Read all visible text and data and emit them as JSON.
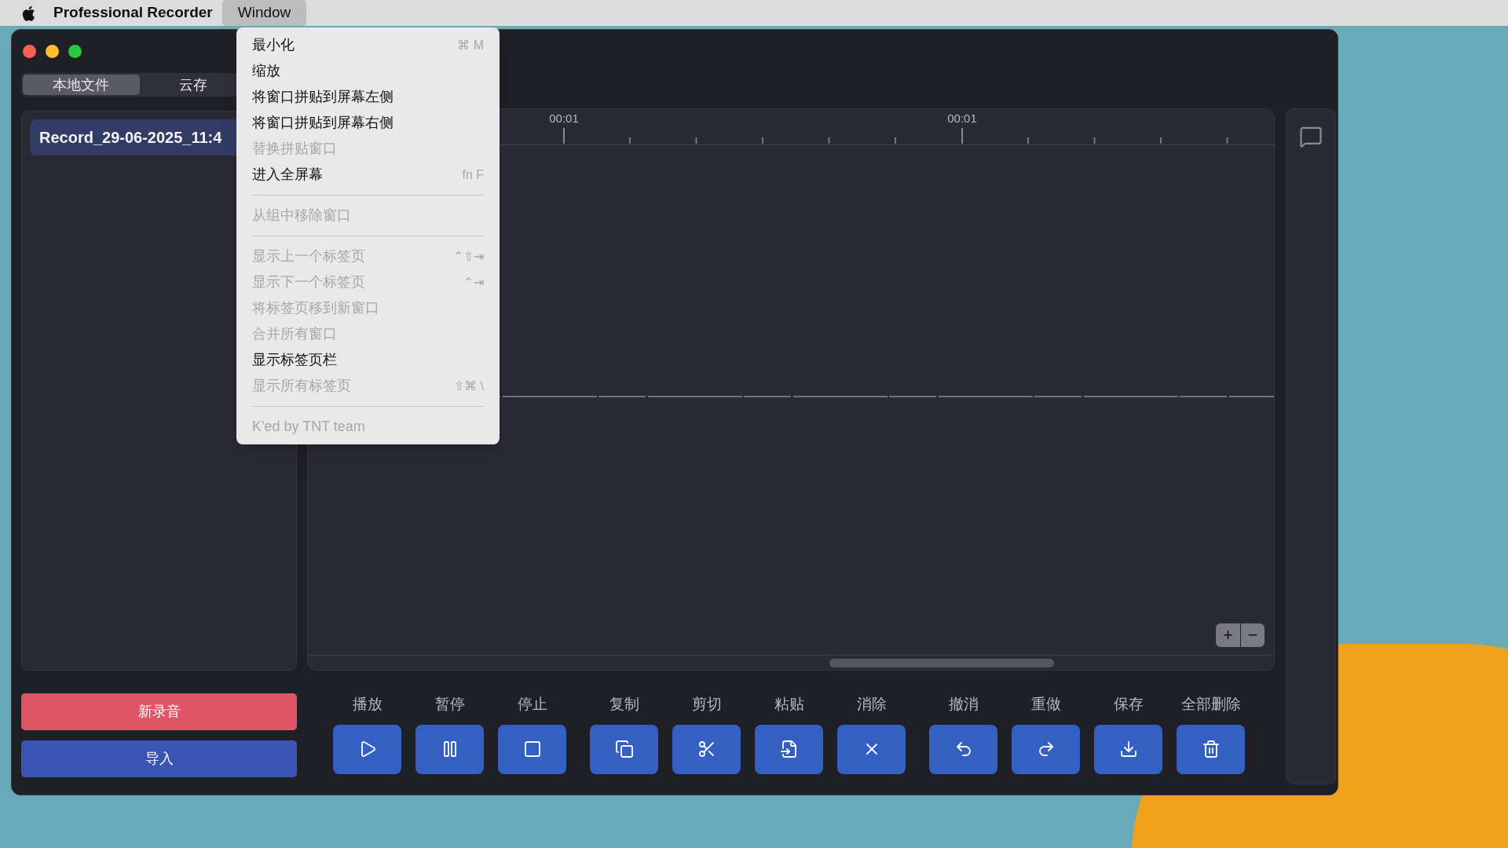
{
  "menubar": {
    "app_name": "Professional Recorder",
    "menus": [
      {
        "label": "Window",
        "selected": true
      }
    ]
  },
  "window_menu": {
    "items": [
      {
        "kind": "item",
        "label": "最小化",
        "shortcut": "⌘ M",
        "disabled": false
      },
      {
        "kind": "item",
        "label": "缩放",
        "disabled": false
      },
      {
        "kind": "item",
        "label": "将窗口拼贴到屏幕左侧",
        "disabled": false
      },
      {
        "kind": "item",
        "label": "将窗口拼贴到屏幕右侧",
        "disabled": false
      },
      {
        "kind": "item",
        "label": "替换拼贴窗口",
        "disabled": true
      },
      {
        "kind": "item",
        "label": "进入全屏幕",
        "shortcut": "fn F",
        "disabled": false
      },
      {
        "kind": "separator"
      },
      {
        "kind": "item",
        "label": "从组中移除窗口",
        "disabled": true
      },
      {
        "kind": "separator"
      },
      {
        "kind": "item",
        "label": "显示上一个标签页",
        "shortcut": "⌃⇧⇥",
        "disabled": true
      },
      {
        "kind": "item",
        "label": "显示下一个标签页",
        "shortcut": "⌃⇥",
        "disabled": true
      },
      {
        "kind": "item",
        "label": "将标签页移到新窗口",
        "disabled": true
      },
      {
        "kind": "item",
        "label": "合并所有窗口",
        "disabled": true
      },
      {
        "kind": "item",
        "label": "显示标签页栏",
        "disabled": false
      },
      {
        "kind": "item",
        "label": "显示所有标签页",
        "shortcut": "⇧⌘ \\",
        "disabled": true
      },
      {
        "kind": "separator"
      },
      {
        "kind": "item",
        "label": "K'ed by TNT team",
        "disabled": true
      }
    ]
  },
  "sidebar": {
    "tabs": [
      {
        "label": "本地文件",
        "selected": true
      },
      {
        "label": "云存",
        "selected": false
      }
    ],
    "files": [
      {
        "name": "Record_29-06-2025_11:4",
        "selected": true
      }
    ],
    "buttons": [
      {
        "label": "新录音",
        "color": "#e05565"
      },
      {
        "label": "导入",
        "color": "#3a54b4"
      }
    ]
  },
  "timeline": {
    "ruler_labels": [
      "00:01",
      "00:01"
    ],
    "zoom_buttons": [
      "+",
      "−"
    ]
  },
  "toolbar": [
    {
      "buttons": [
        "播放",
        "暂停",
        "停止"
      ]
    },
    {
      "buttons": [
        "复制",
        "剪切",
        "粘贴",
        "消除"
      ]
    },
    {
      "buttons": [
        "撤消",
        "重做",
        "保存",
        "全部删除"
      ]
    }
  ]
}
